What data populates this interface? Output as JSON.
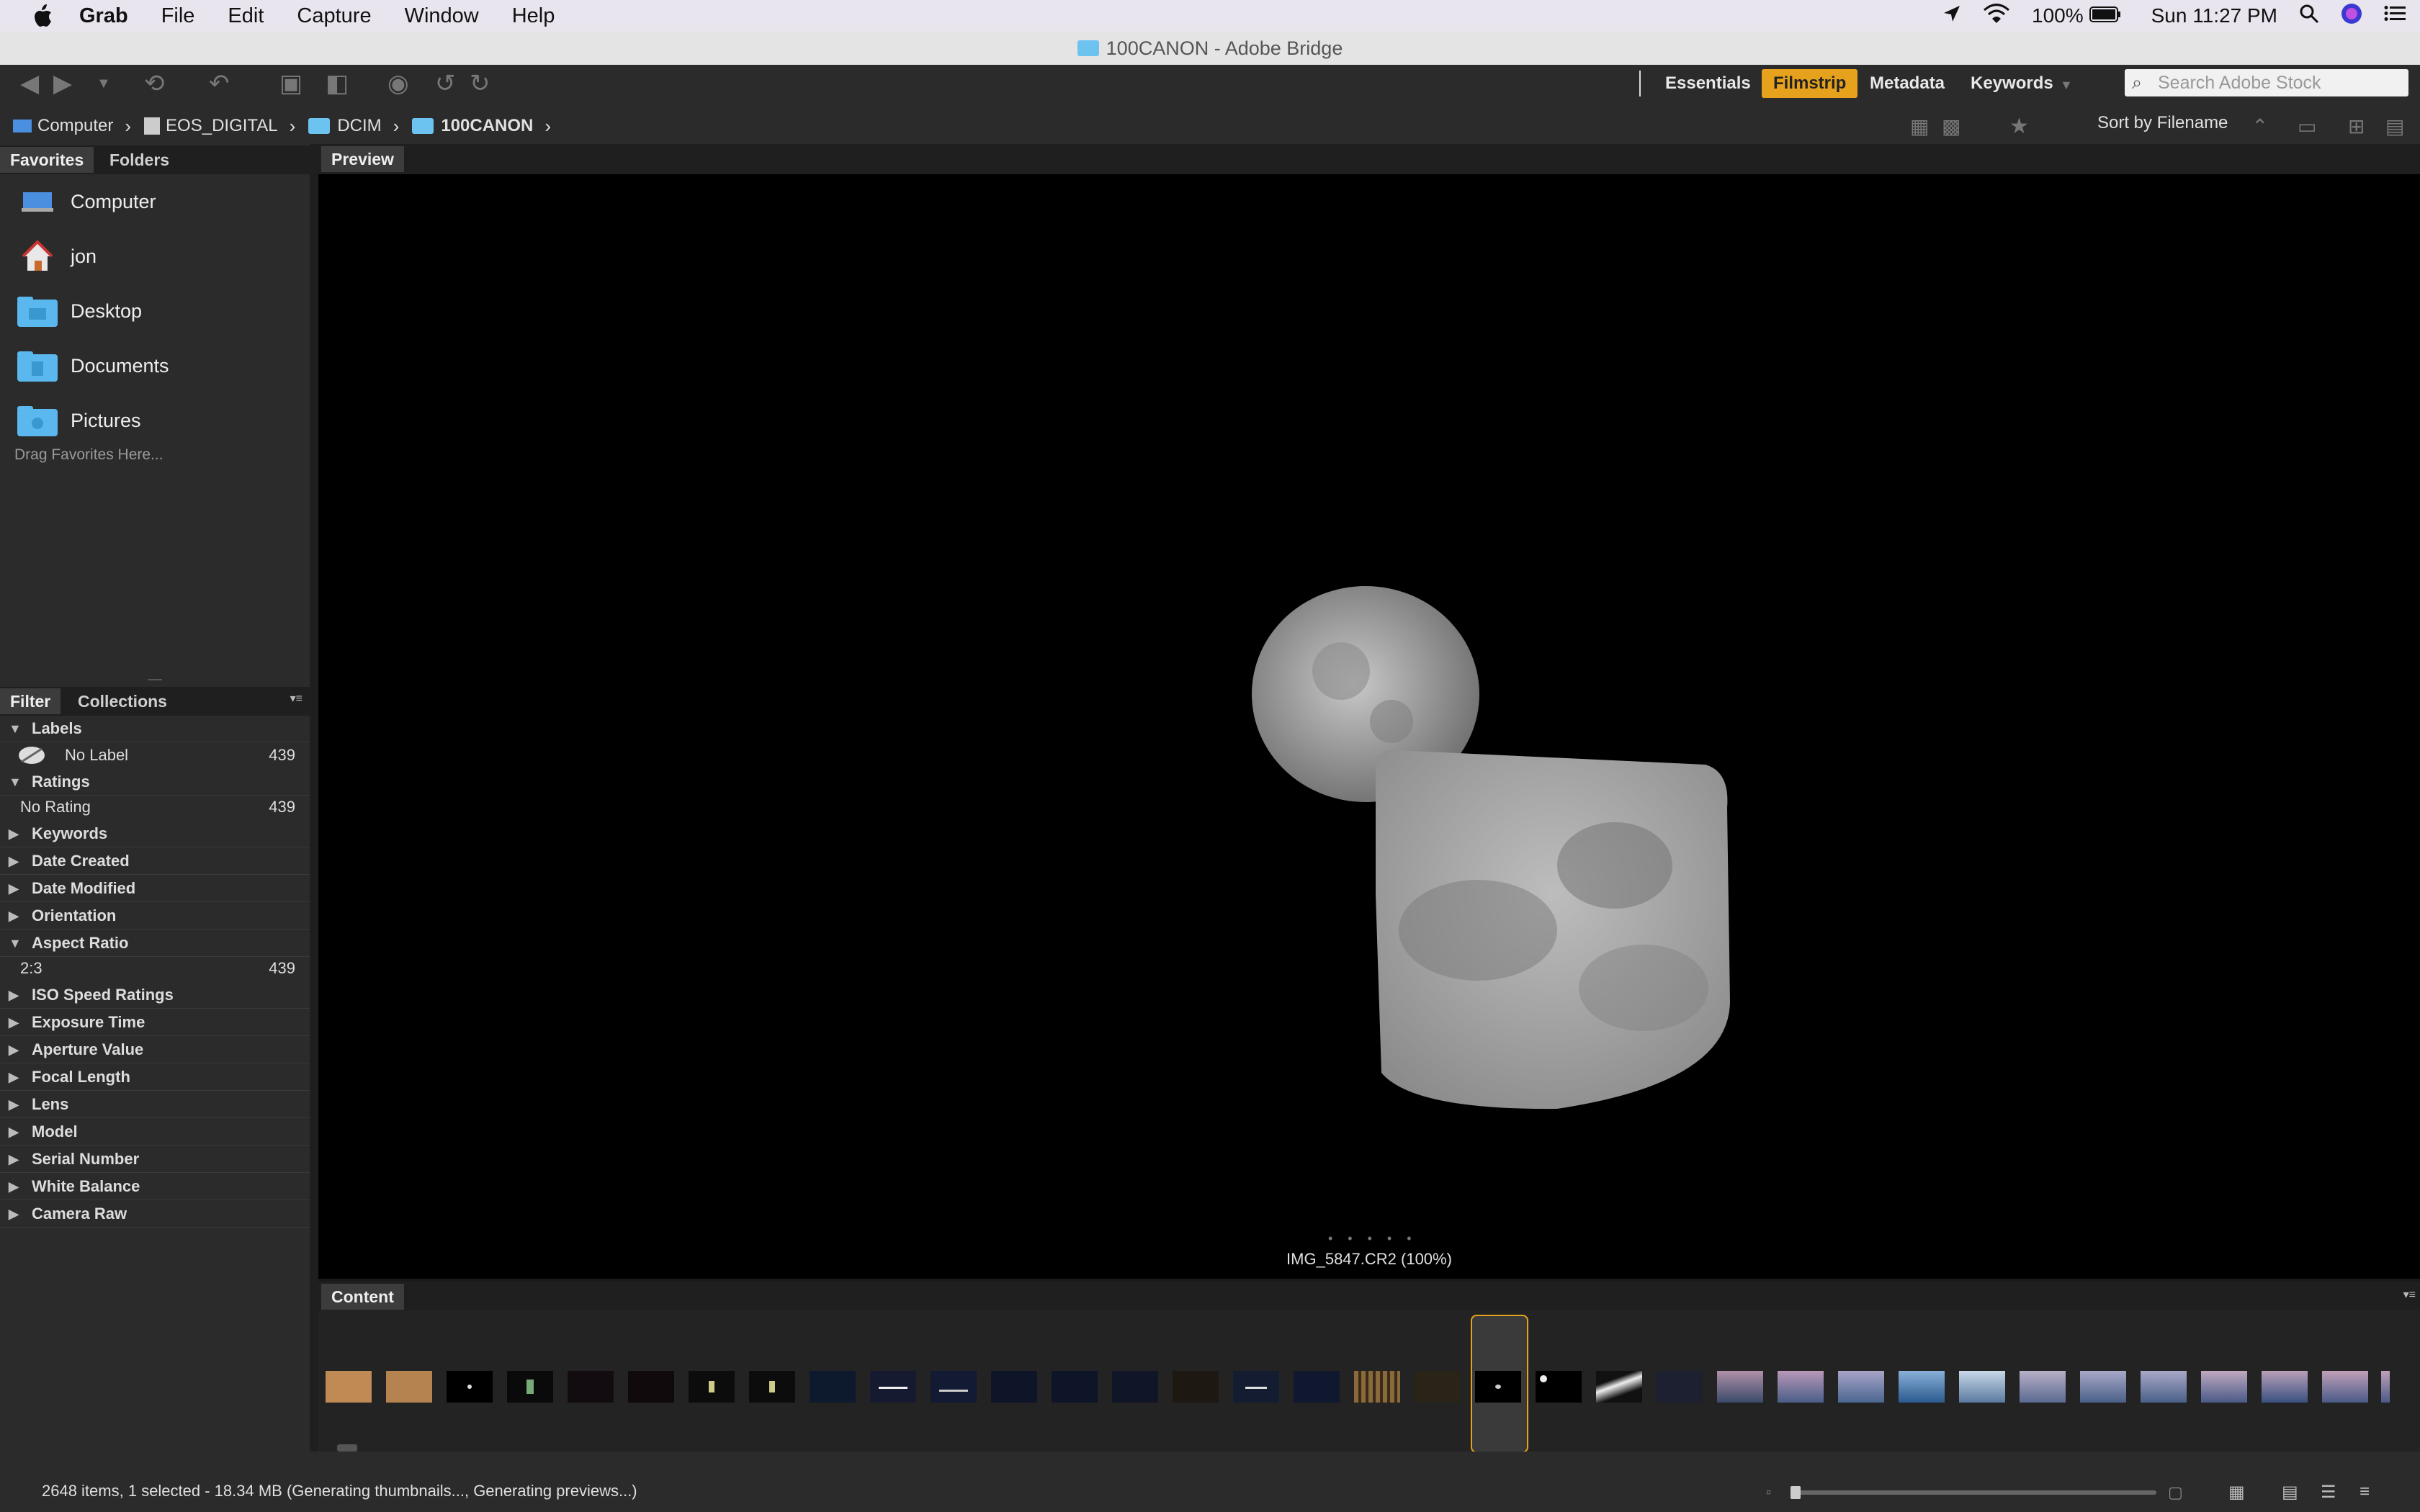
{
  "menubar": {
    "app_name": "Grab",
    "menus": [
      "File",
      "Edit",
      "Capture",
      "Window",
      "Help"
    ],
    "battery": "100%",
    "clock": "Sun 11:27 PM"
  },
  "window": {
    "title": "100CANON - Adobe Bridge"
  },
  "workspaces": {
    "items": [
      "Essentials",
      "Filmstrip",
      "Metadata",
      "Keywords"
    ],
    "active": "Filmstrip"
  },
  "search": {
    "placeholder": "Search Adobe Stock"
  },
  "breadcrumb": [
    "Computer",
    "EOS_DIGITAL",
    "DCIM",
    "100CANON"
  ],
  "sort": {
    "label": "Sort by Filename"
  },
  "favorites_panel": {
    "tabs": [
      "Favorites",
      "Folders"
    ],
    "items": [
      "Computer",
      "jon",
      "Desktop",
      "Documents",
      "Pictures"
    ],
    "hint": "Drag Favorites Here..."
  },
  "filter_panel": {
    "tabs": [
      "Filter",
      "Collections"
    ],
    "labels_header": "Labels",
    "no_label": "No Label",
    "no_label_count": "439",
    "ratings_header": "Ratings",
    "no_rating": "No Rating",
    "no_rating_count": "439",
    "keywords": "Keywords",
    "date_created": "Date Created",
    "date_modified": "Date Modified",
    "orientation": "Orientation",
    "aspect_header": "Aspect Ratio",
    "aspect_value": "2:3",
    "aspect_count": "439",
    "iso": "ISO Speed Ratings",
    "exposure": "Exposure Time",
    "aperture": "Aperture Value",
    "focal": "Focal Length",
    "lens": "Lens",
    "model": "Model",
    "serial": "Serial Number",
    "white_balance": "White Balance",
    "camera_raw": "Camera Raw"
  },
  "preview": {
    "tab": "Preview",
    "caption": "IMG_5847.CR2 (100%)"
  },
  "content": {
    "tab": "Content"
  },
  "status": {
    "text": "2648 items, 1 selected - 18.34 MB (Generating thumbnails..., Generating previews...)"
  },
  "colors": {
    "accent": "#e6a21c",
    "panel": "#2b2b2b",
    "folder": "#6cc3f0"
  }
}
